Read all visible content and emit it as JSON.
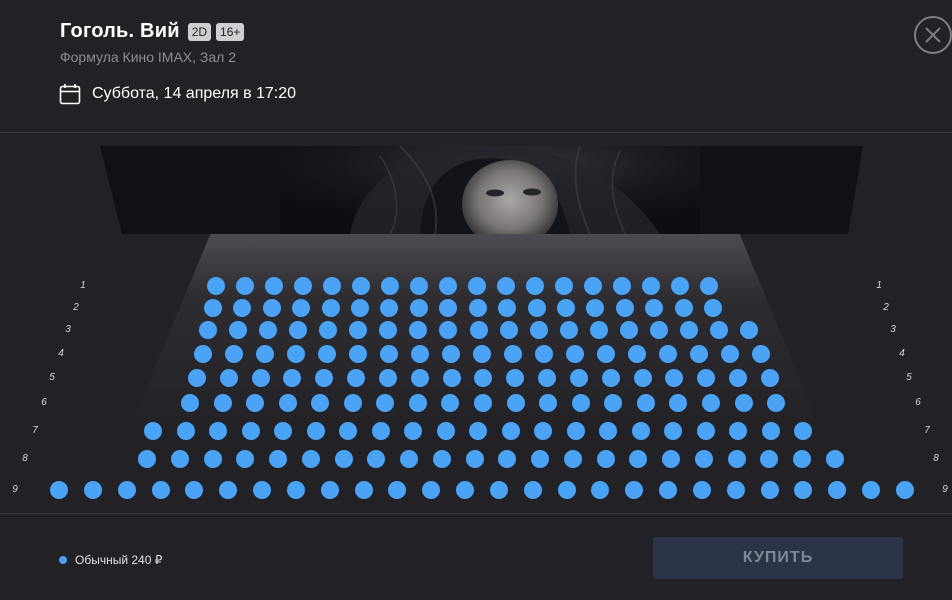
{
  "header": {
    "title": "Гоголь. Вий",
    "badges": [
      "2D",
      "16+"
    ],
    "venue": "Формула Кино IMAX, Зал 2",
    "datetime": "Суббота, 14 апреля в 17:20",
    "close_icon": "close-icon",
    "calendar_icon": "calendar-icon"
  },
  "hall": {
    "screen": "movie-screen-image",
    "rows": [
      {
        "label": "1",
        "seats": 18
      },
      {
        "label": "2",
        "seats": 18
      },
      {
        "label": "3",
        "seats": 19
      },
      {
        "label": "4",
        "seats": 19
      },
      {
        "label": "5",
        "seats": 19
      },
      {
        "label": "6",
        "seats": 19
      },
      {
        "label": "7",
        "seats": 21
      },
      {
        "label": "8",
        "seats": 22
      },
      {
        "label": "9",
        "seats": 26
      }
    ],
    "seat_color": "#4aa3f5",
    "seat_status": "available"
  },
  "footer": {
    "legend_label": "Обычный 240 ₽",
    "legend_color": "#4aa3f5",
    "buy_label": "КУПИТЬ"
  }
}
